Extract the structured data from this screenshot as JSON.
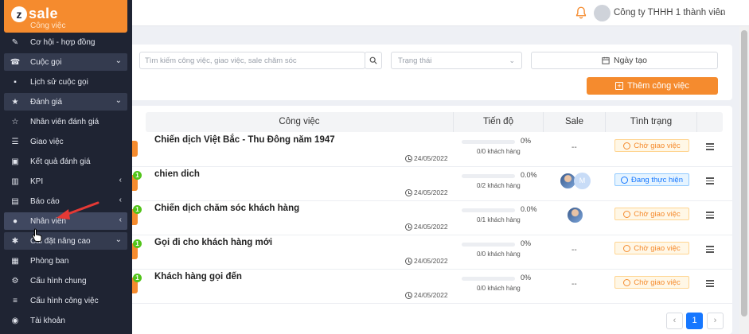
{
  "app": {
    "logo_letter": "z",
    "logo_text": "sale"
  },
  "header": {
    "company": "Công ty THHH 1 thành viên",
    "caret": "⌄"
  },
  "sidebar": {
    "active_partial": "Công việc",
    "items": [
      {
        "label": "Cơ hội - hợp đồng",
        "icon": "✎"
      },
      {
        "label": "Cuộc gọi",
        "icon": "☎",
        "arrow": "⌄"
      },
      {
        "label": "Lịch sử cuộc gọi",
        "icon": "▪"
      },
      {
        "label": "Đánh giá",
        "icon": "★",
        "arrow": "⌄"
      },
      {
        "label": "Nhân viên đánh giá",
        "icon": "☆"
      },
      {
        "label": "Giao việc",
        "icon": "☰"
      },
      {
        "label": "Kết quả đánh giá",
        "icon": "▣"
      },
      {
        "label": "KPI",
        "icon": "▥",
        "arrow": "‹"
      },
      {
        "label": "Báo cáo",
        "icon": "▤",
        "arrow": "‹"
      },
      {
        "label": "Nhân viên",
        "icon": "●",
        "arrow": "‹"
      },
      {
        "label": "Cài đặt nâng cao",
        "icon": "✱",
        "arrow": "⌄"
      },
      {
        "label": "Phòng ban",
        "icon": "▦"
      },
      {
        "label": "Cấu hình chung",
        "icon": "⚙"
      },
      {
        "label": "Cấu hình công việc",
        "icon": "≡"
      },
      {
        "label": "Tài khoản",
        "icon": "◉"
      }
    ]
  },
  "filters": {
    "search_placeholder": "Tìm kiếm công việc, giao việc, sale chăm sóc",
    "status_placeholder": "Trạng thái",
    "date_label": "Ngày tạo",
    "add_task_label": "Thêm công việc"
  },
  "table": {
    "headers": {
      "task": "Công việc",
      "progress": "Tiến độ",
      "sale": "Sale",
      "status": "Tình trạng"
    },
    "rows": [
      {
        "title": "Chiến dịch Việt Bắc - Thu Đông năm 1947",
        "date": "24/05/2022",
        "percent": "0%",
        "progress": 0,
        "customers": "0/0 khách hàng",
        "sale": "--",
        "status": "Chờ giao việc",
        "status_kind": "wait",
        "new_count": ""
      },
      {
        "title": "chien dich",
        "date": "24/05/2022",
        "percent": "0.0%",
        "progress": 0,
        "customers": "0/2 khách hàng",
        "sale": "",
        "avatar_letter": "M",
        "status": "Đang thực hiện",
        "status_kind": "active",
        "new_count": "1"
      },
      {
        "title": "Chiến dịch chăm sóc khách hàng",
        "date": "24/05/2022",
        "percent": "0.0%",
        "progress": 0,
        "customers": "0/1 khách hàng",
        "sale": "",
        "status": "Chờ giao việc",
        "status_kind": "wait",
        "new_count": "1"
      },
      {
        "title": "Gọi đi cho khách hàng mới",
        "date": "24/05/2022",
        "percent": "0%",
        "progress": 0,
        "customers": "0/0 khách hàng",
        "sale": "--",
        "status": "Chờ giao việc",
        "status_kind": "wait",
        "new_count": "1"
      },
      {
        "title": "Khách hàng gọi đến",
        "date": "24/05/2022",
        "percent": "0%",
        "progress": 0,
        "customers": "0/0 khách hàng",
        "sale": "--",
        "status": "Chờ giao việc",
        "status_kind": "wait",
        "new_count": "1"
      }
    ]
  },
  "pagination": {
    "prev": "‹",
    "current": "1",
    "next": "›"
  },
  "colors": {
    "accent": "#f58b2e",
    "sidebar_bg": "#1f2433",
    "primary": "#1677ff",
    "annotation": "#e53935"
  }
}
